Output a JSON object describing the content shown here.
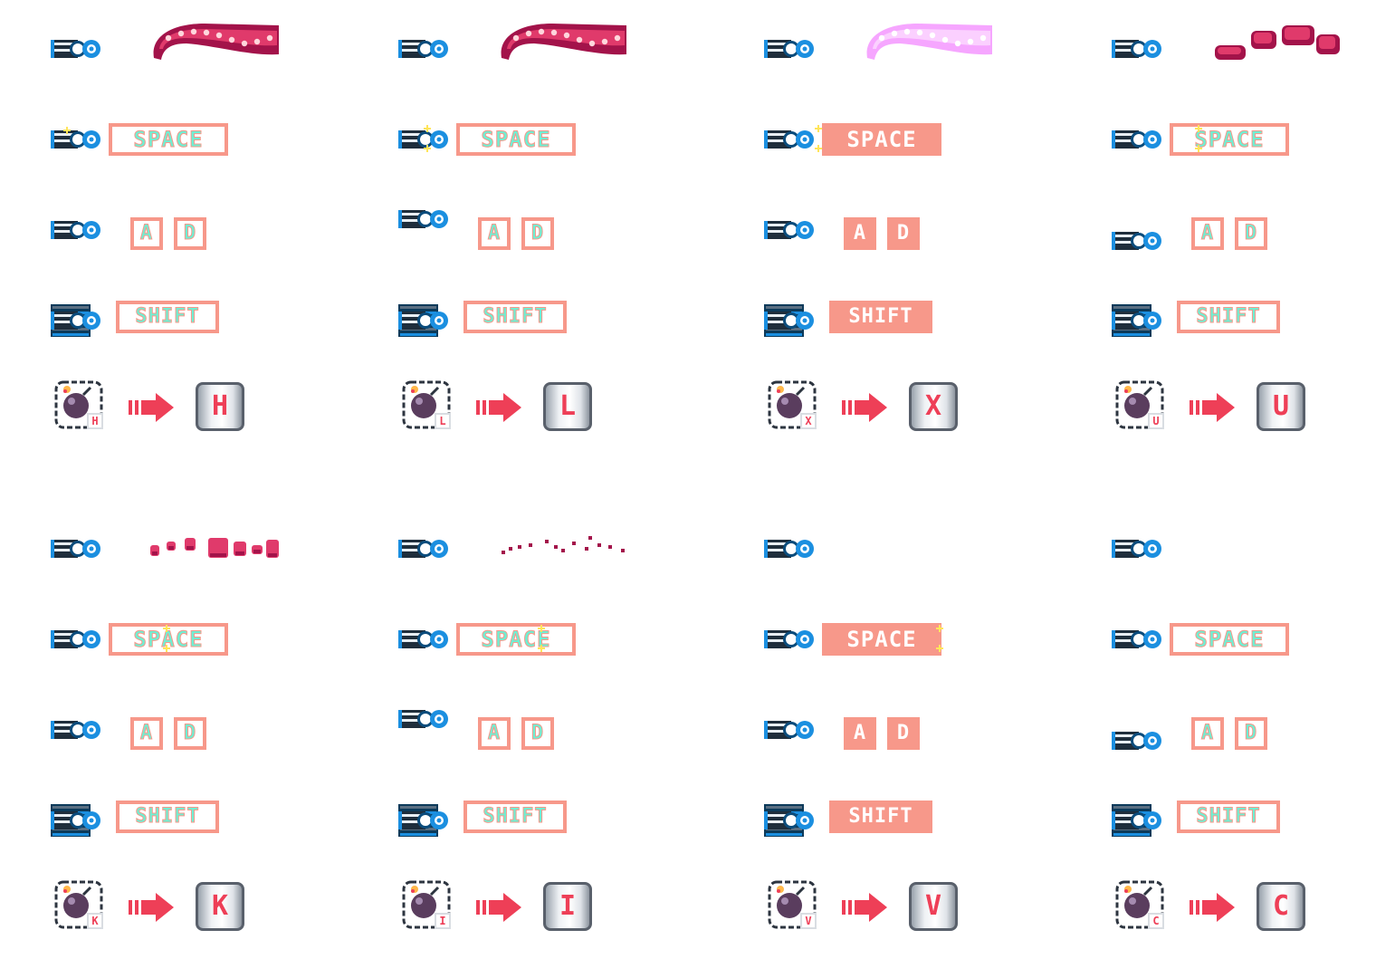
{
  "colors": {
    "key_border": "#f7988a",
    "key_text": "#6ef0d4",
    "accent_red": "#ee3f57",
    "wave_dark": "#a3134a",
    "wave_mid": "#e03a6b",
    "wave_pale": "#f6a6ff",
    "ship_blue": "#1b8fe0",
    "sparkle": "#ffe55a"
  },
  "keys": {
    "space": "SPACE",
    "a": "A",
    "d": "D",
    "shift": "SHIFT"
  },
  "icons": {
    "ship": "ship-icon",
    "wave": "tentacle-wave-icon",
    "bomb": "bomb-icon",
    "arrow": "right-arrow-icon",
    "sparkle": "sparkle-icon"
  },
  "frames": [
    {
      "letter": "H",
      "wave": "full",
      "space_style": "normal",
      "ad_style": "normal",
      "shift_style": "normal"
    },
    {
      "letter": "L",
      "wave": "full",
      "space_style": "normal",
      "ad_style": "normal",
      "shift_style": "normal"
    },
    {
      "letter": "X",
      "wave": "pale",
      "space_style": "flash",
      "ad_style": "flash",
      "shift_style": "flash"
    },
    {
      "letter": "U",
      "wave": "breaking",
      "space_style": "normal",
      "ad_style": "normal",
      "shift_style": "normal"
    },
    {
      "letter": "K",
      "wave": "scatter",
      "space_style": "normal",
      "ad_style": "normal",
      "shift_style": "normal"
    },
    {
      "letter": "I",
      "wave": "dust",
      "space_style": "normal",
      "ad_style": "normal",
      "shift_style": "normal"
    },
    {
      "letter": "V",
      "wave": "none",
      "space_style": "flash",
      "ad_style": "flash",
      "shift_style": "flash"
    },
    {
      "letter": "C",
      "wave": "none",
      "space_style": "normal",
      "ad_style": "normal",
      "shift_style": "normal"
    }
  ]
}
